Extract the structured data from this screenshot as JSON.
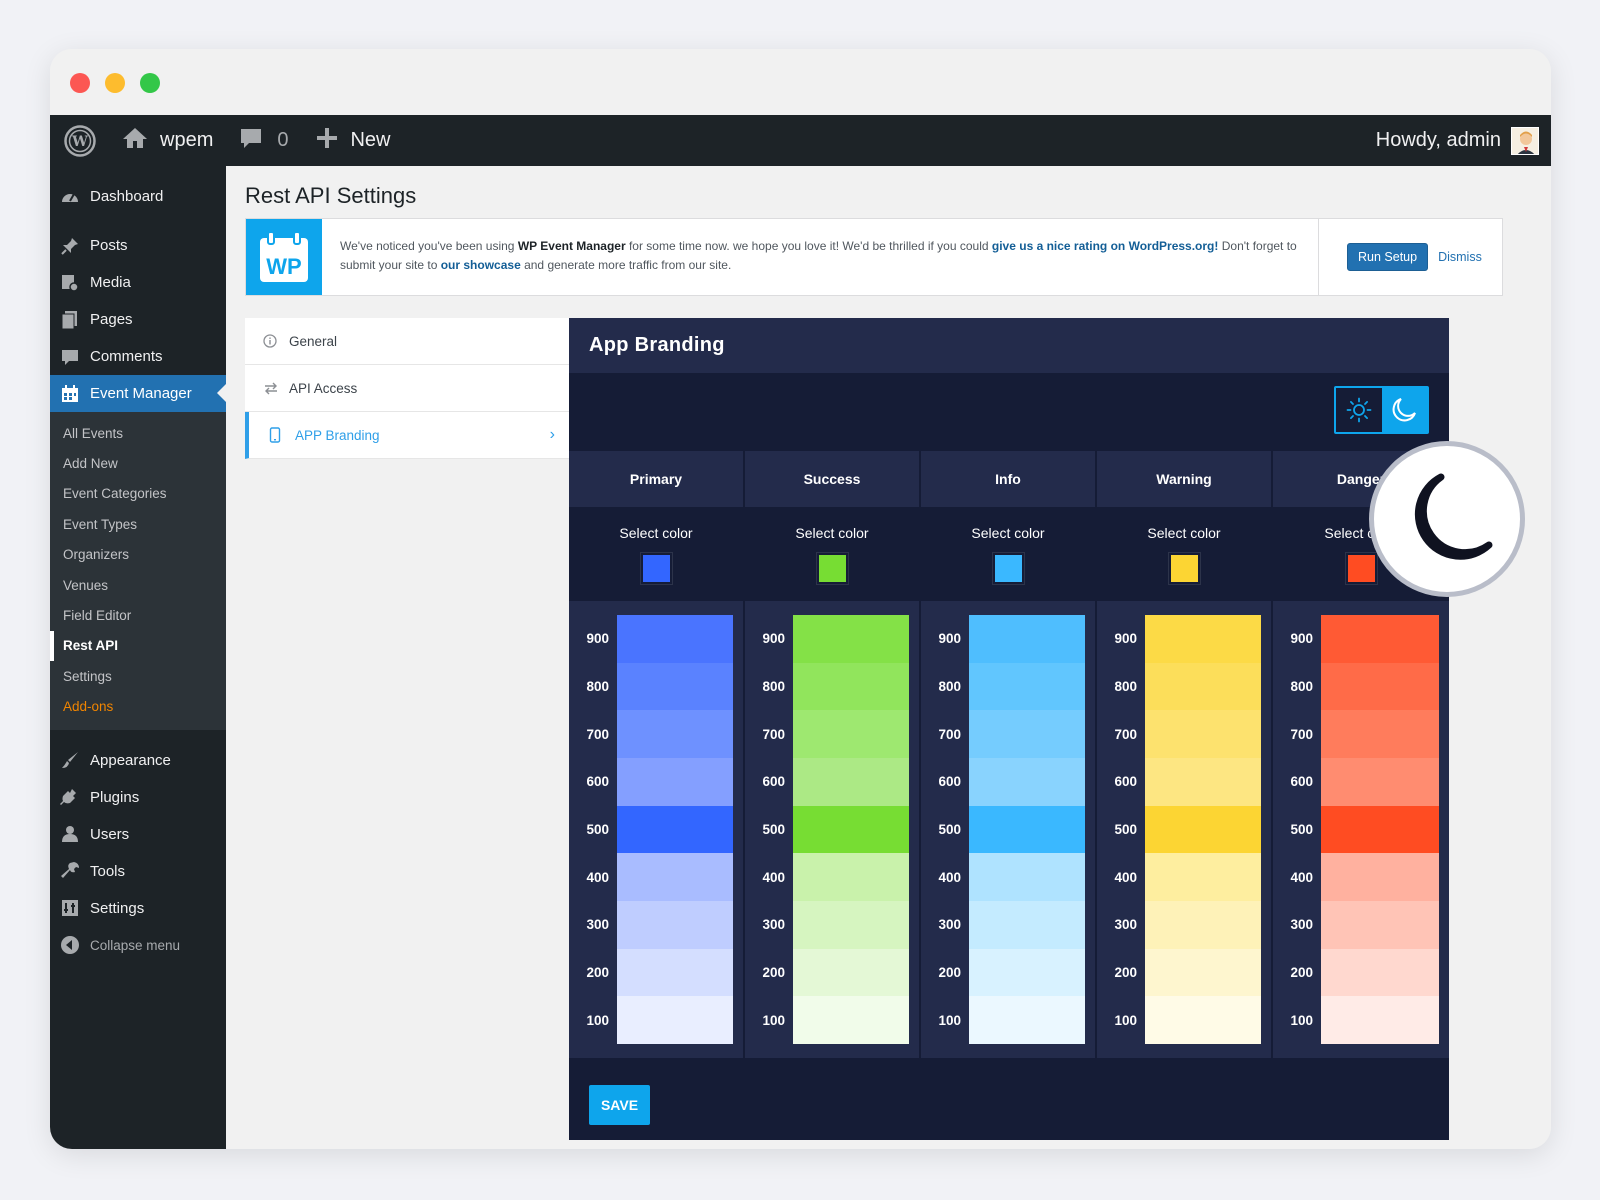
{
  "admin_bar": {
    "site_name": "wpem",
    "comments_count": "0",
    "new_label": "New",
    "howdy": "Howdy, admin"
  },
  "sidebar": {
    "top_items": [
      {
        "label": "Dashboard",
        "icon": "dashboard-icon"
      },
      {
        "label": "Posts",
        "icon": "pin-icon"
      },
      {
        "label": "Media",
        "icon": "media-icon"
      },
      {
        "label": "Pages",
        "icon": "pages-icon"
      },
      {
        "label": "Comments",
        "icon": "comment-icon"
      },
      {
        "label": "Event Manager",
        "icon": "calendar-icon"
      }
    ],
    "submenu": [
      "All Events",
      "Add New",
      "Event Categories",
      "Event Types",
      "Organizers",
      "Venues",
      "Field Editor",
      "Rest API",
      "Settings",
      "Add-ons"
    ],
    "bottom_items": [
      {
        "label": "Appearance",
        "icon": "brush-icon"
      },
      {
        "label": "Plugins",
        "icon": "plugin-icon"
      },
      {
        "label": "Users",
        "icon": "user-icon"
      },
      {
        "label": "Tools",
        "icon": "wrench-icon"
      },
      {
        "label": "Settings",
        "icon": "settings-icon"
      }
    ],
    "collapse": "Collapse menu",
    "accent": "#2271b1"
  },
  "page": {
    "title": "Rest API Settings"
  },
  "notice": {
    "logo_text": "WP",
    "text_1": "We've noticed you've been using ",
    "plugin_name": "WP Event Manager",
    "text_2": " for some time now. we hope you love it! We'd be thrilled if you could ",
    "rating_link": "give us a nice rating on WordPress.org!",
    "text_3": " Don't forget to submit your site to ",
    "showcase_link": "our showcase",
    "text_4": " and generate more traffic from our site.",
    "run_setup": "Run Setup",
    "dismiss": "Dismiss"
  },
  "settings_tabs": [
    {
      "label": "General",
      "icon": "info-icon"
    },
    {
      "label": "API Access",
      "icon": "swap-icon"
    },
    {
      "label": "APP Branding",
      "icon": "phone-icon"
    }
  ],
  "branding": {
    "title": "App Branding",
    "select_label": "Select color",
    "save": "SAVE",
    "shade_labels": [
      "900",
      "800",
      "700",
      "600",
      "500",
      "400",
      "300",
      "200",
      "100"
    ],
    "columns": [
      {
        "name": "Primary",
        "swatch": "#3366ff",
        "shades": [
          "#4a74ff",
          "#5a82ff",
          "#6e91ff",
          "#849fff",
          "#3366ff",
          "#a9bcff",
          "#bfcdff",
          "#d4deff",
          "#e9eeff"
        ]
      },
      {
        "name": "Success",
        "swatch": "#77dd33",
        "shades": [
          "#84e147",
          "#91e55c",
          "#9ee870",
          "#ace985",
          "#77dd33",
          "#c9f2ab",
          "#d6f5c0",
          "#e4f8d6",
          "#f1fcea"
        ]
      },
      {
        "name": "Info",
        "swatch": "#3ab8ff",
        "shades": [
          "#4fbefe",
          "#61c6fe",
          "#75ccfe",
          "#89d3fe",
          "#3ab8ff",
          "#afe3ff",
          "#c4ebff",
          "#d8f2ff",
          "#ebf8ff"
        ]
      },
      {
        "name": "Warning",
        "swatch": "#fcd533",
        "shades": [
          "#fcda46",
          "#fcde5a",
          "#fde26e",
          "#fde682",
          "#fcd533",
          "#feee9f",
          "#fef2b8",
          "#fef6cf",
          "#fffbe7"
        ]
      },
      {
        "name": "Danger",
        "swatch": "#ff4c22",
        "shades": [
          "#ff5a34",
          "#ff6b48",
          "#ff7c5c",
          "#ff8c70",
          "#ff4c22",
          "#ffb19f",
          "#ffc4b6",
          "#ffd8cf",
          "#ffebe7"
        ]
      }
    ],
    "colors": {
      "header": "#232b4b",
      "panel": "#151c36",
      "accent": "#0ea5ec"
    }
  }
}
